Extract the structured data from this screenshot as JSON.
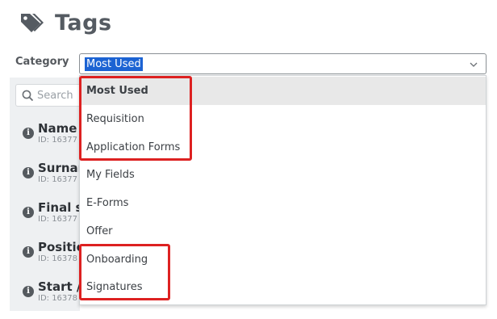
{
  "header": {
    "title": "Tags",
    "icon": "tags-icon"
  },
  "category": {
    "label": "Category",
    "selected": "Most Used",
    "options": [
      "Most Used",
      "Requisition",
      "Application Forms",
      "My Fields",
      "E-Forms",
      "Offer",
      "Onboarding",
      "Signatures"
    ]
  },
  "search": {
    "placeholder": "Search"
  },
  "fields": [
    {
      "name": "Name",
      "id": "ID: 16377"
    },
    {
      "name": "Surnar",
      "id": "ID: 16377"
    },
    {
      "name": "Final st",
      "id": "ID: 16377"
    },
    {
      "name": "Positio",
      "id": "ID: 16378"
    },
    {
      "name": "Start /",
      "id": "ID: 16378"
    }
  ],
  "colors": {
    "highlight": "#dd2121",
    "selection": "#1c63d3"
  }
}
